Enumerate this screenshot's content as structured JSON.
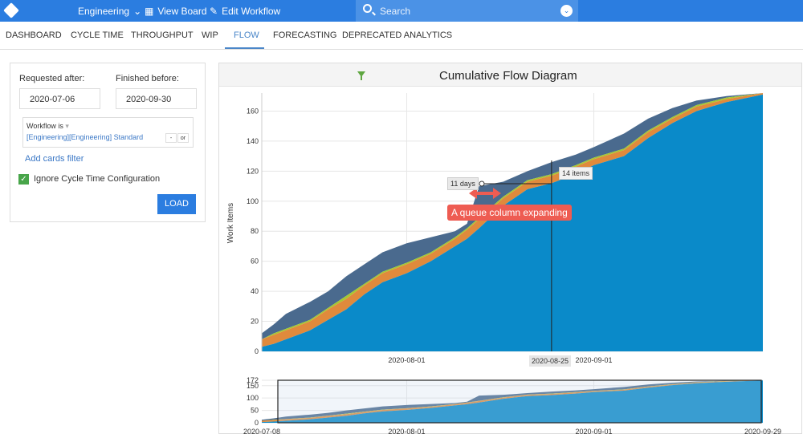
{
  "topbar": {
    "team": "Engineering",
    "view_board": "View Board",
    "edit_workflow": "Edit Workflow",
    "search_placeholder": "Search"
  },
  "tabs": [
    "DASHBOARD",
    "CYCLE TIME",
    "THROUGHPUT",
    "WIP",
    "FLOW",
    "FORECASTING",
    "DEPRECATED ANALYTICS"
  ],
  "active_tab": "FLOW",
  "filters": {
    "requested_after_label": "Requested after:",
    "requested_after": "2020-07-06",
    "finished_before_label": "Finished before:",
    "finished_before": "2020-09-30",
    "workflow_label": "Workflow",
    "workflow_op": "is",
    "workflow_value": "[Engineering][Engineering] Standard",
    "minus": "-",
    "or": "or",
    "add_filter": "Add cards filter",
    "ignore_cycle_time": "Ignore Cycle Time Configuration",
    "ignore_checked": true,
    "load": "LOAD"
  },
  "chart_title": "Cumulative Flow Diagram",
  "annotations": {
    "days": "11 days",
    "items": "14 items",
    "crosshair_date": "2020-08-25",
    "callout": "A queue column expanding"
  },
  "chart_data": {
    "type": "area",
    "title": "Cumulative Flow Diagram",
    "ylabel": "Work Items",
    "ylim": [
      0,
      172
    ],
    "yticks": [
      0,
      20,
      40,
      60,
      80,
      100,
      120,
      140,
      160
    ],
    "xticks": [
      "2020-08-01",
      "2020-09-01"
    ],
    "xlim": [
      "2020-07-08",
      "2020-09-29"
    ],
    "colors": [
      "#0a8ac9",
      "#e08a3c",
      "#a6c832",
      "#4a6a8e"
    ],
    "dates": [
      "2020-07-08",
      "2020-07-10",
      "2020-07-12",
      "2020-07-16",
      "2020-07-19",
      "2020-07-22",
      "2020-07-25",
      "2020-07-28",
      "2020-08-01",
      "2020-08-05",
      "2020-08-09",
      "2020-08-11",
      "2020-08-13",
      "2020-08-17",
      "2020-08-21",
      "2020-08-25",
      "2020-08-29",
      "2020-09-01",
      "2020-09-06",
      "2020-09-10",
      "2020-09-14",
      "2020-09-18",
      "2020-09-23",
      "2020-09-29"
    ],
    "series": [
      {
        "values": [
          3,
          5,
          8,
          14,
          21,
          28,
          38,
          46,
          52,
          60,
          70,
          75,
          82,
          97,
          108,
          112,
          118,
          124,
          130,
          142,
          152,
          160,
          166,
          171
        ]
      },
      {
        "values": [
          5,
          6,
          6,
          6,
          7,
          7,
          6,
          6,
          6,
          5,
          5,
          6,
          6,
          5,
          5,
          5,
          5,
          4,
          4,
          4,
          3,
          3,
          2,
          1
        ]
      },
      {
        "values": [
          0,
          1,
          1,
          1,
          1,
          2,
          1,
          1,
          1,
          1,
          1,
          1,
          1,
          1,
          1,
          1,
          1,
          1,
          1,
          1,
          1,
          1,
          1,
          0
        ]
      },
      {
        "values": [
          4,
          6,
          10,
          12,
          11,
          13,
          13,
          13,
          13,
          10,
          4,
          3,
          21,
          10,
          6,
          8,
          7,
          7,
          10,
          8,
          6,
          3,
          1,
          0
        ]
      }
    ],
    "navigator": {
      "yticks": [
        0,
        50,
        100,
        150,
        172
      ],
      "xticks": [
        "2020-07-08",
        "2020-08-01",
        "2020-09-01",
        "2020-09-29"
      ]
    }
  }
}
